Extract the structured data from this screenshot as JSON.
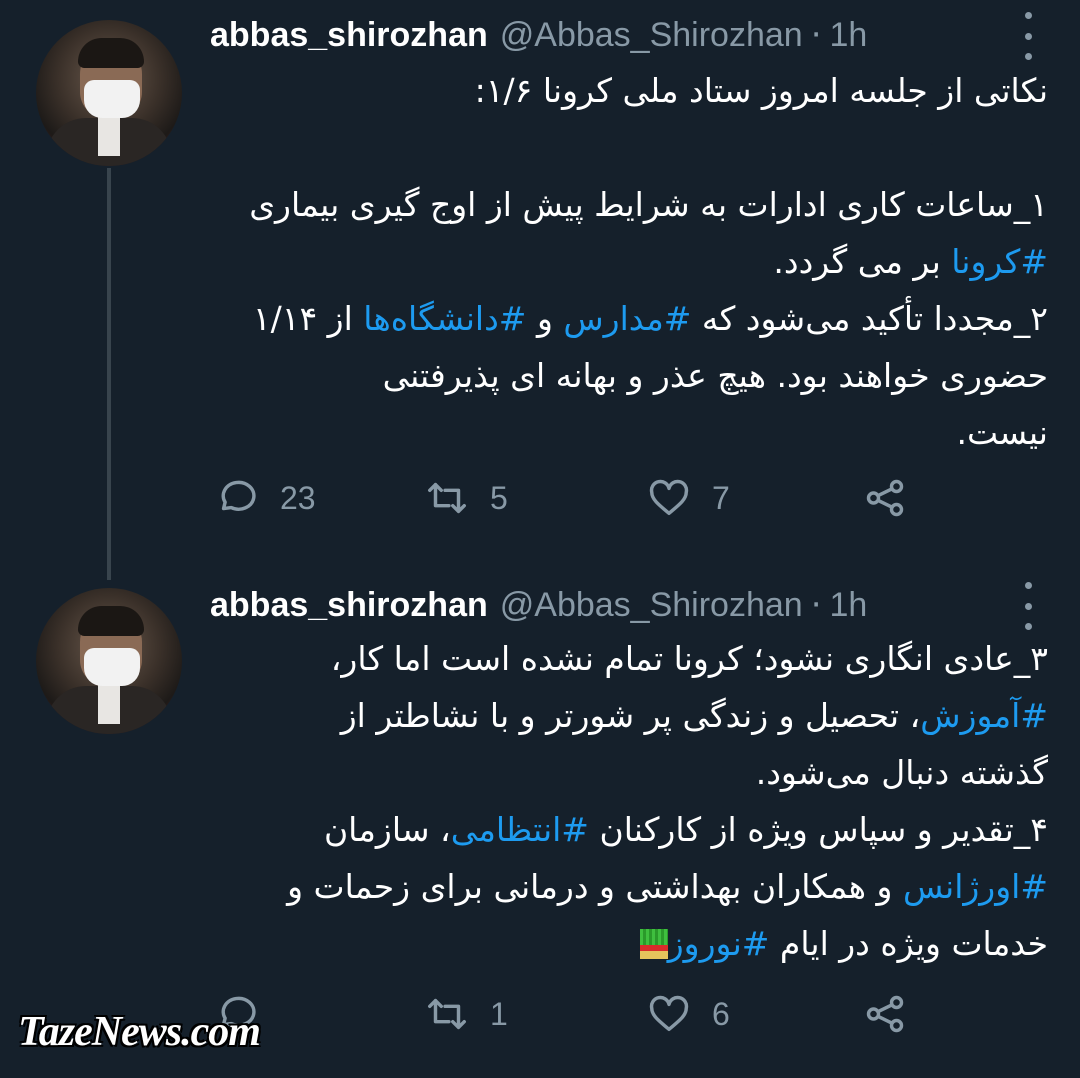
{
  "tweets": [
    {
      "name": "abbas_shirozhan",
      "handle": "@Abbas_Shirozhan",
      "dot": "·",
      "time": "1h",
      "lines": [
        [
          {
            "t": "نکاتی از جلسه امروز ستاد ملی کرونا ۱/۶:"
          }
        ],
        [],
        [
          {
            "t": "۱_ساعات کاری ادارات به شرایط پیش از اوج گیری بیماری"
          }
        ],
        [
          {
            "t": "#کرونا",
            "h": true
          },
          {
            "t": " بر می گردد."
          }
        ],
        [
          {
            "t": "۲_مجددا تأکید می‌شود که "
          },
          {
            "t": "#مدارس",
            "h": true
          },
          {
            "t": " و "
          },
          {
            "t": "#دانشگاه‌ها",
            "h": true
          },
          {
            "t": " از ۱/۱۴"
          }
        ],
        [
          {
            "t": "حضوری خواهند بود. هیچ عذر و بهانه ای پذیرفتنی"
          }
        ],
        [
          {
            "t": "نیست."
          }
        ]
      ],
      "reply_count": "23",
      "retweet_count": "5",
      "like_count": "7"
    },
    {
      "name": "abbas_shirozhan",
      "handle": "@Abbas_Shirozhan",
      "dot": "·",
      "time": "1h",
      "lines": [
        [
          {
            "t": "۳_عادی انگاری نشود؛ کرونا تمام نشده است اما کار،"
          }
        ],
        [
          {
            "t": "#آموزش",
            "h": true
          },
          {
            "t": "، تحصیل و زندگی پر شورتر و با نشاطتر از"
          }
        ],
        [
          {
            "t": "گذشته دنبال می‌شود."
          }
        ],
        [
          {
            "t": "۴_تقدیر و سپاس ویژه از کارکنان "
          },
          {
            "t": "#انتظامی",
            "h": true
          },
          {
            "t": "، سازمان"
          }
        ],
        [
          {
            "t": "#اورژانس",
            "h": true
          },
          {
            "t": " و همکاران بهداشتی و درمانی برای زحمات و"
          }
        ],
        [
          {
            "t": "خدمات ویژه در ایام "
          },
          {
            "t": "#نوروز",
            "h": true
          },
          {
            "e": "sabzeh-emoji"
          }
        ]
      ],
      "reply_count": "",
      "retweet_count": "1",
      "like_count": "6"
    }
  ],
  "icons": [
    "more-vertical-icon",
    "reply-icon",
    "retweet-icon",
    "like-icon",
    "share-icon"
  ],
  "colors": {
    "background": "#15202b",
    "secondary_text": "#8899a6",
    "hashtag": "#1d9bf0",
    "thread_line": "#38444d"
  },
  "watermark": "TazeNews.com"
}
